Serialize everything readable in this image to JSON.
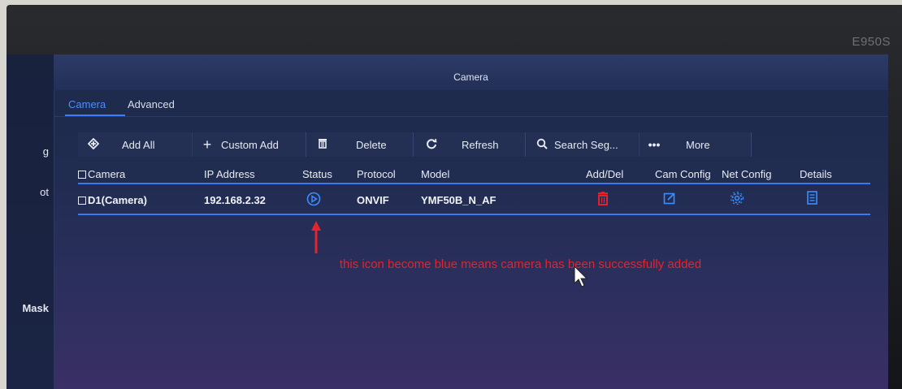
{
  "monitor": {
    "brand": "E950S"
  },
  "window": {
    "title": "Camera"
  },
  "sidebar": {
    "items": [
      {
        "label": "g"
      },
      {
        "label": "ot"
      },
      {
        "label": "Mask"
      }
    ]
  },
  "tabs": [
    {
      "label": "Camera",
      "active": true
    },
    {
      "label": "Advanced",
      "active": false
    }
  ],
  "toolbar": {
    "add_all": {
      "label": "Add All",
      "icon": "add-all-icon"
    },
    "custom_add": {
      "label": "Custom Add",
      "icon": "plus-icon"
    },
    "delete": {
      "label": "Delete",
      "icon": "trash-icon"
    },
    "refresh": {
      "label": "Refresh",
      "icon": "refresh-icon"
    },
    "search": {
      "label": "Search Seg...",
      "icon": "search-icon"
    },
    "more": {
      "label": "More",
      "icon": "ellipsis-icon"
    }
  },
  "table": {
    "columns": [
      "Camera",
      "IP Address",
      "Status",
      "Protocol",
      "Model",
      "Add/Del",
      "Cam Config",
      "Net Config",
      "Details"
    ],
    "rows": [
      {
        "camera": "D1(Camera)",
        "ip": "192.168.2.32",
        "status_icon": "play-circle-icon",
        "protocol": "ONVIF",
        "model": "YMF50B_N_AF",
        "add_del_icon": "trash-icon",
        "cam_config_icon": "edit-icon",
        "net_config_icon": "gear-icon",
        "details_icon": "list-icon"
      }
    ]
  },
  "annotation": {
    "text": "this icon become blue means camera has been successfully added",
    "color": "#e2242e"
  },
  "colors": {
    "accent": "#3b78f0",
    "screen_bg": "#202c50",
    "status_icon": "#3b8dff",
    "delete_icon": "#e0242c"
  }
}
